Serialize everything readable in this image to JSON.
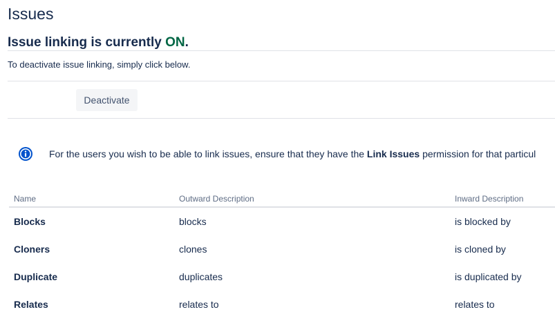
{
  "page": {
    "title": "Issues"
  },
  "status": {
    "prefix": "Issue linking is currently ",
    "state": "ON",
    "suffix": "."
  },
  "instruction": "To deactivate issue linking, simply click below.",
  "actions": {
    "deactivate_label": "Deactivate"
  },
  "info": {
    "icon": "info-icon",
    "text_before": "For the users you wish to be able to link issues, ensure that they have the ",
    "text_bold": "Link Issues",
    "text_after": " permission for that particul"
  },
  "table": {
    "headers": {
      "name": "Name",
      "outward": "Outward Description",
      "inward": "Inward Description"
    },
    "rows": [
      {
        "name": "Blocks",
        "outward": "blocks",
        "inward": "is blocked by"
      },
      {
        "name": "Cloners",
        "outward": "clones",
        "inward": "is cloned by"
      },
      {
        "name": "Duplicate",
        "outward": "duplicates",
        "inward": "is duplicated by"
      },
      {
        "name": "Relates",
        "outward": "relates to",
        "inward": "relates to"
      }
    ]
  },
  "colors": {
    "text": "#172b4d",
    "status_on": "#006644",
    "info_icon": "#0052cc",
    "muted": "#5e6c84",
    "button_bg": "#f4f5f7",
    "divider": "#dfe1e6"
  }
}
